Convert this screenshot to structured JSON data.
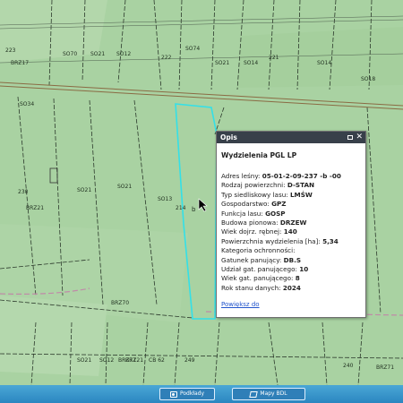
{
  "map": {
    "parcel_labels": [
      "223",
      "BRZ17",
      "SO70",
      "SO21",
      "SO12",
      "222",
      "SO74",
      "SO21",
      "SO14",
      "221",
      "SO14",
      "SO18",
      "SO34",
      "230",
      "BRZ21",
      "SO21",
      "SO21",
      "214",
      "SO13",
      "BRZ70",
      "249",
      "SO21",
      "SO12",
      "BRZ21",
      "CB 62",
      "BRZ71",
      "240",
      "BRZ71"
    ],
    "highlighted_parcel_label": "b"
  },
  "popup": {
    "header_title": "Opis",
    "title": "Wydzielenia PGL LP",
    "rows": [
      {
        "label": "Adres leśny: ",
        "value": "05-01-2-09-237   -b   -00"
      },
      {
        "label": "Rodzaj powierzchni: ",
        "value": "D-STAN"
      },
      {
        "label": "Typ siedliskowy lasu: ",
        "value": "LMŚW"
      },
      {
        "label": "Gospodarstwo: ",
        "value": "GPZ"
      },
      {
        "label": "Funkcja lasu: ",
        "value": "GOSP"
      },
      {
        "label": "Budowa pionowa: ",
        "value": "DRZEW"
      },
      {
        "label": "Wiek dojrz. rębnej: ",
        "value": "140"
      },
      {
        "label": "Powierzchnia wydzielenia [ha]: ",
        "value": "5,34"
      },
      {
        "label": "Kategoria ochronności:",
        "value": ""
      },
      {
        "label": "Gatunek panujący: ",
        "value": "DB.S"
      },
      {
        "label": "Udział gat. panującego: ",
        "value": "10"
      },
      {
        "label": "Wiek gat. panującego: ",
        "value": "8"
      },
      {
        "label": "Rok stanu danych: ",
        "value": "2024"
      }
    ],
    "link": "Powiększ do"
  },
  "toolbar": {
    "left_button": "Podkłady",
    "right_button": "Mapy BDL"
  },
  "colors": {
    "map_green": "#a9d2a2",
    "highlight": "#33e0e8",
    "road": "#8a6b44",
    "toolbar": "#2b86c0"
  }
}
